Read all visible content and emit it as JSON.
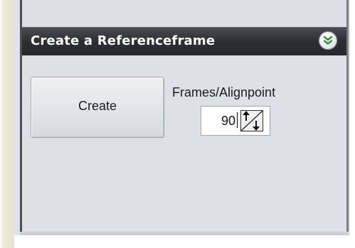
{
  "section": {
    "title": "Create a Referenceframe",
    "collapse_icon": "double-chevron-down-icon"
  },
  "create_button": {
    "label": "Create"
  },
  "frames": {
    "label": "Frames/Alignpoint",
    "value": "90",
    "spinner_icon": "up-down-arrows-icon"
  },
  "colors": {
    "header_bg": "#2c2e33",
    "panel_bg": "#dde1e7",
    "header_text": "#ffffff"
  }
}
